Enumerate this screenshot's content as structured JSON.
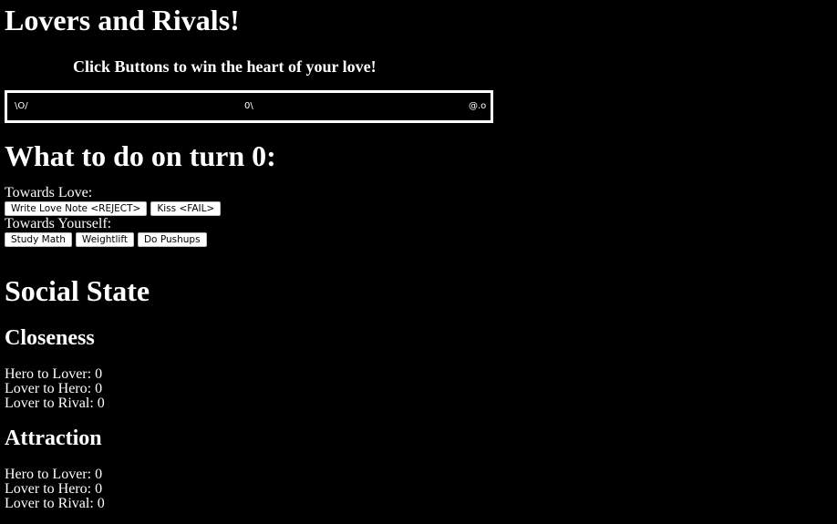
{
  "title": "Lovers and Rivals!",
  "subtitle": "Click Buttons to win the heart of your love!",
  "stage": {
    "hero": "\\O/",
    "lover": "0\\",
    "rival": "@.o"
  },
  "turn": {
    "heading": "What to do on turn 0:",
    "towards_love_label": "Towards Love:",
    "love_buttons": [
      "Write Love Note <REJECT>",
      "Kiss <FAIL>"
    ],
    "towards_self_label": "Towards Yourself:",
    "self_buttons": [
      "Study Math",
      "Weightlift",
      "Do Pushups"
    ]
  },
  "social": {
    "heading": "Social State",
    "closeness": {
      "heading": "Closeness",
      "lines": [
        "Hero to Lover: 0",
        "Lover to Hero: 0",
        "Lover to Rival: 0"
      ]
    },
    "attraction": {
      "heading": "Attraction",
      "lines": [
        "Hero to Lover: 0",
        "Lover to Hero: 0",
        "Lover to Rival: 0"
      ]
    }
  }
}
